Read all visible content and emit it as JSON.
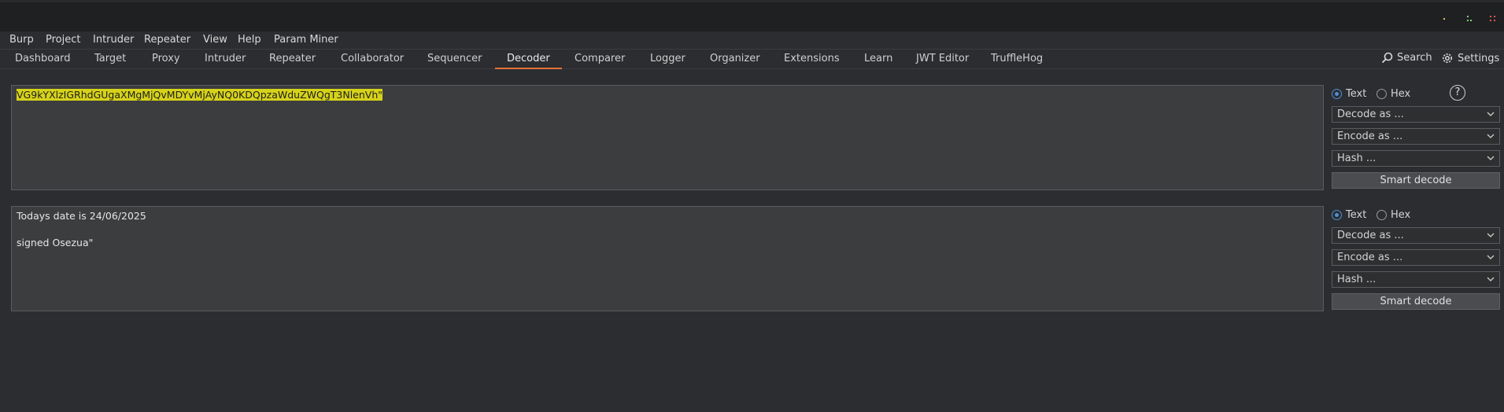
{
  "menubar": {
    "items": [
      "Burp",
      "Project",
      "Intruder",
      "Repeater",
      "View",
      "Help",
      "Param Miner"
    ]
  },
  "tabs": {
    "items": [
      "Dashboard",
      "Target",
      "Proxy",
      "Intruder",
      "Repeater",
      "Collaborator",
      "Sequencer",
      "Decoder",
      "Comparer",
      "Logger",
      "Organizer",
      "Extensions",
      "Learn",
      "JWT Editor",
      "TruffleHog"
    ],
    "active": "Decoder",
    "search_label": "Search",
    "settings_label": "Settings"
  },
  "panel1": {
    "content": "VG9kYXlzIGRhdGUgaXMgMjQvMDYvMjAyNQ0KDQpzaWduZWQgT3NlenVh\"",
    "text_label": "Text",
    "hex_label": "Hex",
    "decode_label": "Decode as ...",
    "encode_label": "Encode as ...",
    "hash_label": "Hash ...",
    "smart_label": "Smart decode",
    "help_label": "?"
  },
  "panel2": {
    "lines": [
      "Todays date is 24/06/2025",
      "",
      "signed Osezua\""
    ],
    "text_label": "Text",
    "hex_label": "Hex",
    "decode_label": "Decode as ...",
    "encode_label": "Encode as ...",
    "hash_label": "Hash ...",
    "smart_label": "Smart decode"
  },
  "colors": {
    "accent": "#e8713c",
    "highlight": "#d6d21a",
    "radio_selected": "#4d8fd6",
    "background": "#2b2d30"
  }
}
